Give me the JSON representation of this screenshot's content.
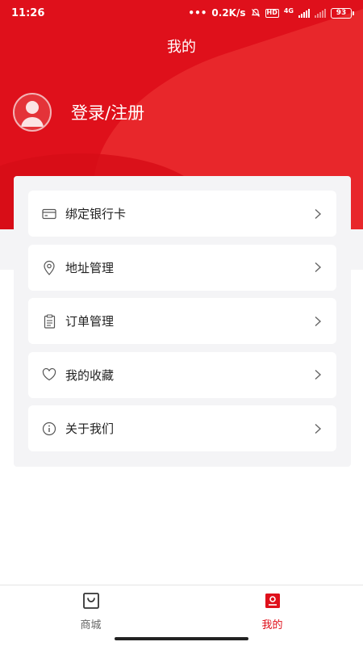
{
  "status_bar": {
    "time": "11:26",
    "net_speed": "0.2K/s",
    "hd": "HD",
    "network": "4G",
    "battery": "93"
  },
  "header": {
    "title": "我的"
  },
  "profile": {
    "login_label": "登录/注册"
  },
  "menu": [
    {
      "label": "绑定银行卡",
      "icon": "bank-card-icon"
    },
    {
      "label": "地址管理",
      "icon": "location-pin-icon"
    },
    {
      "label": "订单管理",
      "icon": "clipboard-icon"
    },
    {
      "label": "我的收藏",
      "icon": "heart-icon"
    },
    {
      "label": "关于我们",
      "icon": "info-icon"
    }
  ],
  "tabs": [
    {
      "label": "商城",
      "icon": "shop-bag-icon",
      "active": false
    },
    {
      "label": "我的",
      "icon": "user-icon",
      "active": true
    }
  ],
  "colors": {
    "brand": "#df101b",
    "panel_bg": "#f4f4f6"
  }
}
